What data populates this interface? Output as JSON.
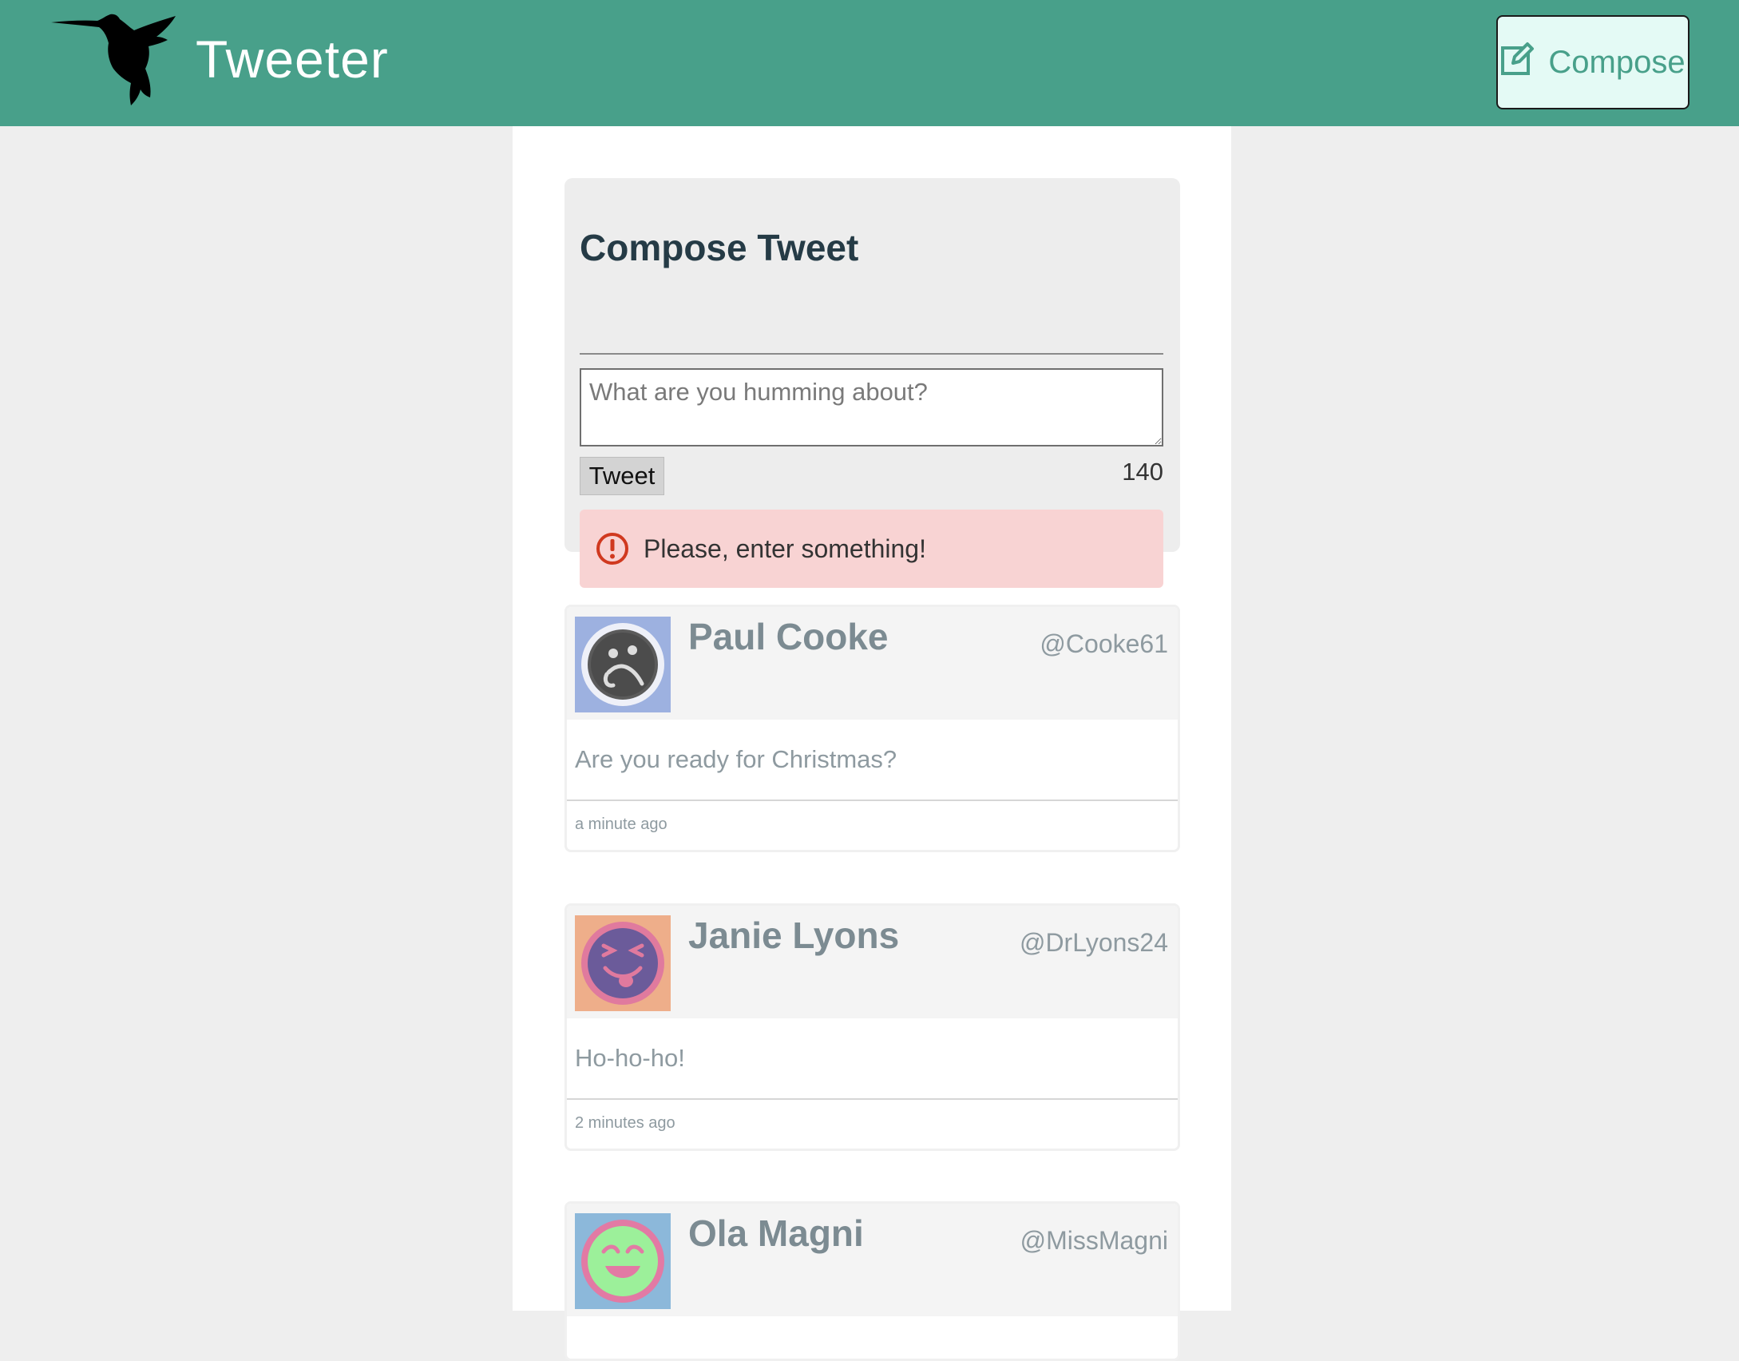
{
  "navbar": {
    "brand": "Tweeter",
    "compose_label": "Compose",
    "background": "#48a08a"
  },
  "compose": {
    "title": "Compose Tweet",
    "placeholder": "What are you humming about?",
    "tweet_button": "Tweet",
    "counter": "140",
    "error": "Please, enter something!"
  },
  "tweets": [
    {
      "name": "Paul Cooke",
      "handle": "@Cooke61",
      "content": "Are you ready for Christmas?",
      "time": "a minute ago",
      "avatar_bg": "#9db1e0"
    },
    {
      "name": "Janie Lyons",
      "handle": "@DrLyons24",
      "content": "Ho-ho-ho!",
      "time": "2 minutes ago",
      "avatar_bg": "#eeae8a"
    },
    {
      "name": "Ola Magni",
      "handle": "@MissMagni",
      "avatar_bg": "#8cb8da"
    }
  ]
}
